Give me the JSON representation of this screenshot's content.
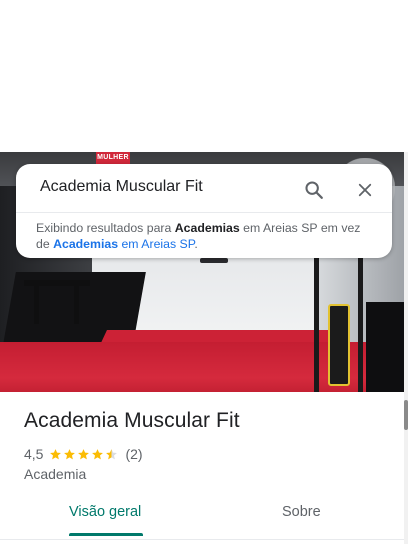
{
  "search": {
    "query": "Academia Muscular Fit",
    "notice": {
      "prefix": "Exibindo resultados para ",
      "shown_term": "Academias",
      "shown_location": " em Areias SP em vez de ",
      "suggested_term": "Academias",
      "suggested_location": " em Areias SP",
      "suffix": "."
    }
  },
  "photo": {
    "sign_text": "MULHER"
  },
  "place": {
    "name": "Academia Muscular Fit",
    "rating": "4,5",
    "rating_value": 4.5,
    "stars_max": 5,
    "review_count": "(2)",
    "category": "Academia"
  },
  "tabs": [
    {
      "label": "Visão geral",
      "active": true
    },
    {
      "label": "Sobre",
      "active": false
    }
  ],
  "colors": {
    "accent_teal": "#00796b",
    "star_gold": "#fbbc04",
    "link_blue": "#1a73e8"
  },
  "icons": {
    "search": "search-icon",
    "close": "close-icon",
    "star": "star-icon"
  }
}
